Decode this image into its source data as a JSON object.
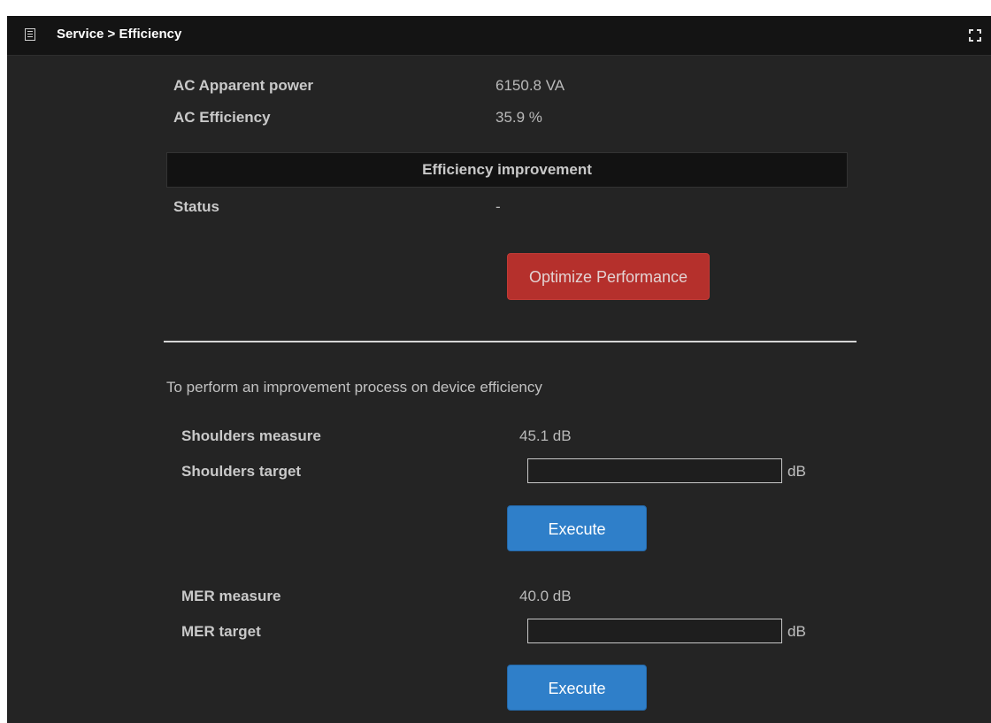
{
  "header": {
    "title": "Service > Efficiency",
    "menu_icon": "list-icon",
    "expand_icon": "expand-icon"
  },
  "ac": {
    "apparent_power_label": "AC Apparent power",
    "apparent_power_value": "6150.8 VA",
    "efficiency_label": "AC Efficiency",
    "efficiency_value": "35.9 %"
  },
  "improvement": {
    "section_title": "Efficiency improvement",
    "status_label": "Status",
    "status_value": "-",
    "optimize_button": "Optimize Performance"
  },
  "process": {
    "description": "To perform an improvement process on device efficiency",
    "shoulders_measure_label": "Shoulders measure",
    "shoulders_measure_value": "45.1 dB",
    "shoulders_target_label": "Shoulders target",
    "shoulders_target_value": "",
    "shoulders_unit": "dB",
    "shoulders_execute": "Execute",
    "mer_measure_label": "MER measure",
    "mer_measure_value": "40.0 dB",
    "mer_target_label": "MER target",
    "mer_target_value": "",
    "mer_unit": "dB",
    "mer_execute": "Execute"
  },
  "colors": {
    "panel_bg": "#242424",
    "header_bg": "#141414",
    "danger": "#b5302c",
    "primary": "#2f7fc9"
  }
}
